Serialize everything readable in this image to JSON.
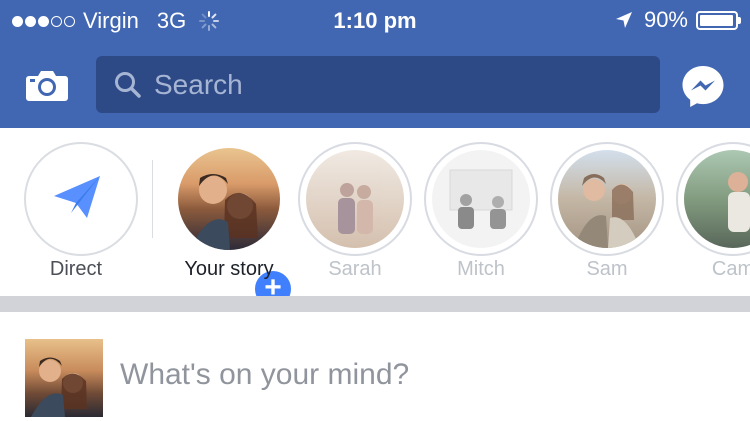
{
  "status_bar": {
    "carrier": "Virgin",
    "network": "3G",
    "time": "1:10 pm",
    "battery": "90%",
    "signal_bars_filled": 3,
    "signal_bars_total": 5
  },
  "header": {
    "search_placeholder": "Search",
    "brand_color": "#4267b2",
    "search_bg": "#2d4a86"
  },
  "stories": [
    {
      "label": "Direct",
      "kind": "direct-icon"
    },
    {
      "label": "Your story",
      "kind": "add-story"
    },
    {
      "label": "Sarah",
      "kind": "viewed"
    },
    {
      "label": "Mitch",
      "kind": "viewed"
    },
    {
      "label": "Sam",
      "kind": "viewed"
    },
    {
      "label": "Cam",
      "kind": "viewed"
    }
  ],
  "composer": {
    "placeholder": "What's on your mind?"
  }
}
